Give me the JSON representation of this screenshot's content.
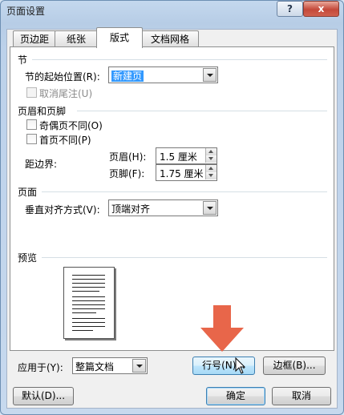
{
  "window": {
    "title": "页面设置",
    "help_label": "?",
    "close_label": "x"
  },
  "tabs": [
    {
      "label": "页边距",
      "active": false
    },
    {
      "label": "纸张",
      "active": false
    },
    {
      "label": "版式",
      "active": true
    },
    {
      "label": "文档网格",
      "active": false
    }
  ],
  "section": {
    "heading": "节",
    "start_label": "节的起始位置(R):",
    "start_value": "新建页",
    "suppress_endnotes_label": "取消尾注(U)"
  },
  "headers_footers": {
    "heading": "页眉和页脚",
    "odd_even_label": "奇偶页不同(O)",
    "first_page_label": "首页不同(P)",
    "from_edge_label": "距边界:",
    "header_label": "页眉(H):",
    "header_value": "1.5 厘米",
    "footer_label": "页脚(F):",
    "footer_value": "1.75 厘米"
  },
  "page": {
    "heading": "页面",
    "valign_label": "垂直对齐方式(V):",
    "valign_value": "顶端对齐"
  },
  "preview": {
    "heading": "预览"
  },
  "bottom": {
    "apply_label": "应用于(Y):",
    "apply_value": "整篇文档",
    "line_numbers_label": "行号(N)...",
    "borders_label": "边框(B)..."
  },
  "footer_buttons": {
    "default_label": "默认(D)...",
    "ok_label": "确定",
    "cancel_label": "取消"
  },
  "colors": {
    "arrow": "#e8664a",
    "selection": "#3399ff"
  }
}
